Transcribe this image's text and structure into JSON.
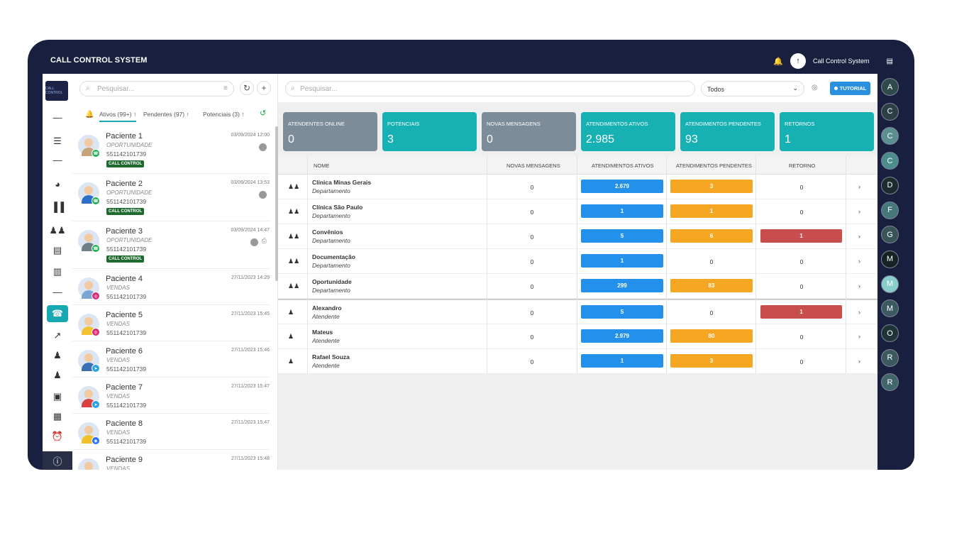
{
  "app": {
    "title": "CALL CONTROL SYSTEM",
    "user_initial": "↑",
    "user_name": "Call Control System",
    "logo_text": "CALL CONTROL"
  },
  "conversations": {
    "search_placeholder": "Pesquisar...",
    "tabs": [
      {
        "label": "Ativos (99+) ↑"
      },
      {
        "label": "Pendentes (97) ↑"
      },
      {
        "label": "Potenciais (3) ↑"
      }
    ],
    "items": [
      {
        "name": "Paciente 1",
        "category": "OPORTUNIDADE",
        "phone": "551142101739",
        "badge": "CALL CONTROL",
        "time": "03/09/2024 12:00",
        "channel": "whatsapp",
        "avatar_color": "#c7a27a"
      },
      {
        "name": "Paciente 2",
        "category": "OPORTUNIDADE",
        "phone": "551142101739",
        "badge": "CALL CONTROL",
        "time": "03/09/2024 13:53",
        "channel": "whatsapp",
        "avatar_color": "#2d6fc7"
      },
      {
        "name": "Paciente 3",
        "category": "OPORTUNIDADE",
        "phone": "551142101739",
        "badge": "CALL CONTROL",
        "time": "03/09/2024 14:47",
        "channel": "whatsapp",
        "avatar_color": "#6f7f86"
      },
      {
        "name": "Paciente 4",
        "category": "VENDAS",
        "phone": "551142101739",
        "badge": "",
        "time": "27/11/2023 14:29",
        "channel": "instagram",
        "avatar_color": "#7aa6d6"
      },
      {
        "name": "Paciente 5",
        "category": "VENDAS",
        "phone": "551142101739",
        "badge": "",
        "time": "27/11/2023 15:45",
        "channel": "instagram",
        "avatar_color": "#f2c232"
      },
      {
        "name": "Paciente 6",
        "category": "VENDAS",
        "phone": "551142101739",
        "badge": "",
        "time": "27/11/2023 15:46",
        "channel": "telegram",
        "avatar_color": "#3a6fb5"
      },
      {
        "name": "Paciente 7",
        "category": "VENDAS",
        "phone": "551142101739",
        "badge": "",
        "time": "27/11/2023 15:47",
        "channel": "telegram",
        "avatar_color": "#d9403f"
      },
      {
        "name": "Paciente 8",
        "category": "VENDAS",
        "phone": "551142101739",
        "badge": "",
        "time": "27/11/2023 15:47",
        "channel": "messenger",
        "avatar_color": "#f3c02a"
      },
      {
        "name": "Paciente 9",
        "category": "VENDAS",
        "phone": "551142101739",
        "badge": "",
        "time": "27/11/2023 15:48",
        "channel": "",
        "avatar_color": "#3a6fb5"
      }
    ]
  },
  "main": {
    "search_placeholder": "Pesquisar...",
    "filter_value": "Todos",
    "tutorial_label": "TUTORIAL",
    "stats": [
      {
        "label": "ATENDENTES ONLINE",
        "value": "0",
        "color": "#7d8c99"
      },
      {
        "label": "POTENCIAIS",
        "value": "3",
        "color": "#17b0b3"
      },
      {
        "label": "NOVAS MENSAGENS",
        "value": "0",
        "color": "#7d8c99"
      },
      {
        "label": "ATENDIMENTOS ATIVOS",
        "value": "2.985",
        "color": "#17b0b3"
      },
      {
        "label": "ATENDIMENTOS PENDENTES",
        "value": "93",
        "color": "#17b0b3"
      },
      {
        "label": "RETORNOS",
        "value": "1",
        "color": "#17b0b3"
      }
    ],
    "table": {
      "headers": [
        "NOME",
        "NOVAS MENSAGENS",
        "ATENDIMENTOS ATIVOS",
        "ATENDIMENTOS PENDENTES",
        "RETORNO"
      ],
      "rows": [
        {
          "name": "Clínica Minas Gerais",
          "type": "Departamento",
          "novas": "0",
          "ativos": "2.679",
          "pendentes": "3",
          "retorno": "0"
        },
        {
          "name": "Clínica São Paulo",
          "type": "Departamento",
          "novas": "0",
          "ativos": "1",
          "pendentes": "1",
          "retorno": "0"
        },
        {
          "name": "Convênios",
          "type": "Departamento",
          "novas": "0",
          "ativos": "5",
          "pendentes": "6",
          "retorno": "1"
        },
        {
          "name": "Documentação",
          "type": "Departamento",
          "novas": "0",
          "ativos": "1",
          "pendentes": "0",
          "retorno": "0"
        },
        {
          "name": "Oportunidade",
          "type": "Departamento",
          "novas": "0",
          "ativos": "299",
          "pendentes": "83",
          "retorno": "0"
        },
        {
          "name": "Alexandro",
          "type": "Atendente",
          "novas": "0",
          "ativos": "5",
          "pendentes": "0",
          "retorno": "1"
        },
        {
          "name": "Mateus",
          "type": "Atendente",
          "novas": "0",
          "ativos": "2.979",
          "pendentes": "80",
          "retorno": "0"
        },
        {
          "name": "Rafael Souza",
          "type": "Atendente",
          "novas": "0",
          "ativos": "1",
          "pendentes": "3",
          "retorno": "0"
        }
      ]
    }
  },
  "users": [
    {
      "initial": "A",
      "color": "#2f4a4a"
    },
    {
      "initial": "C",
      "color": "#2c3f44"
    },
    {
      "initial": "C",
      "color": "#5a9090"
    },
    {
      "initial": "C",
      "color": "#4b8c8c"
    },
    {
      "initial": "D",
      "color": "#1b2b2e"
    },
    {
      "initial": "F",
      "color": "#46777a"
    },
    {
      "initial": "G",
      "color": "#3a5558"
    },
    {
      "initial": "M",
      "color": "#172224"
    },
    {
      "initial": "M",
      "color": "#88cccc"
    },
    {
      "initial": "M",
      "color": "#3b5a60"
    },
    {
      "initial": "O",
      "color": "#1f3436"
    },
    {
      "initial": "R",
      "color": "#3c5a5e"
    },
    {
      "initial": "R",
      "color": "#40666a"
    }
  ]
}
